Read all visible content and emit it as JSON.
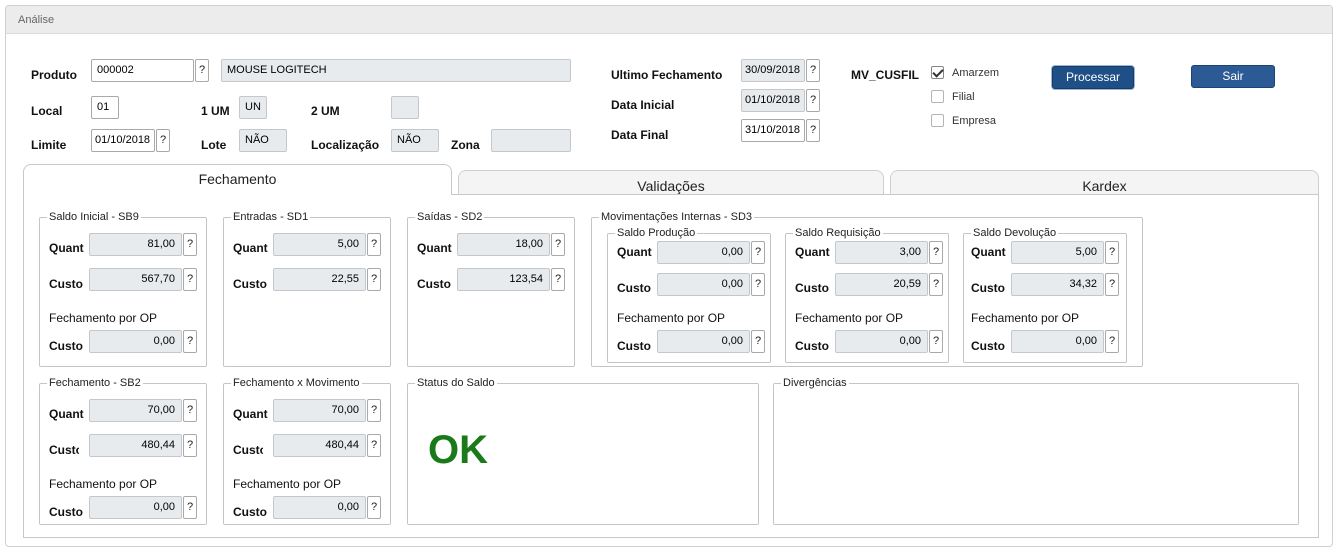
{
  "window": {
    "title": "Análise"
  },
  "header": {
    "produto": {
      "label": "Produto",
      "code": "000002",
      "description": "MOUSE LOGITECH"
    },
    "local": {
      "label": "Local",
      "value": "01"
    },
    "um1": {
      "label": "1 UM",
      "value": "UN"
    },
    "um2": {
      "label": "2 UM",
      "value": ""
    },
    "limite": {
      "label": "Limite",
      "value": "01/10/2018"
    },
    "lote": {
      "label": "Lote",
      "value": "NÃO"
    },
    "localizacao": {
      "label": "Localização",
      "value": "NÃO"
    },
    "zona": {
      "label": "Zona",
      "value": ""
    },
    "ultimo_fechamento": {
      "label": "Ultimo Fechamento",
      "value": "30/09/2018"
    },
    "data_inicial": {
      "label": "Data Inicial",
      "value": "01/10/2018"
    },
    "data_final": {
      "label": "Data Final",
      "value": "31/10/2018"
    },
    "mv_cusfil": {
      "label": "MV_CUSFIL"
    },
    "options": [
      {
        "label": "Amarzem",
        "checked": true
      },
      {
        "label": "Filial",
        "checked": false
      },
      {
        "label": "Empresa",
        "checked": false
      }
    ],
    "help": "?",
    "processar_label": "Processar",
    "sair_label": "Sair"
  },
  "tabs": [
    {
      "label": "Fechamento",
      "active": true
    },
    {
      "label": "Validações",
      "active": false
    },
    {
      "label": "Kardex",
      "active": false
    }
  ],
  "labels": {
    "quant": "Quant",
    "custo": "Custo",
    "custo_clipped": "Custo",
    "fechamento_op": "Fechamento por OP"
  },
  "groups": {
    "saldo_inicial": {
      "title": "Saldo Inicial - SB9",
      "quant": "81,00",
      "custo": "567,70",
      "custo_op": "0,00"
    },
    "entradas": {
      "title": "Entradas - SD1",
      "quant": "5,00",
      "custo": "22,55"
    },
    "saidas": {
      "title": "Saídas - SD2",
      "quant": "18,00",
      "custo": "123,54"
    },
    "mov_internas": {
      "title": "Movimentações Internas - SD3"
    },
    "saldo_producao": {
      "title": "Saldo Produção",
      "quant": "0,00",
      "custo": "0,00",
      "custo_op": "0,00"
    },
    "saldo_requisicao": {
      "title": "Saldo Requisição",
      "quant": "3,00",
      "custo": "20,59",
      "custo_op": "0,00"
    },
    "saldo_devolucao": {
      "title": "Saldo Devolução",
      "quant": "5,00",
      "custo": "34,32",
      "custo_op": "0,00"
    },
    "fechamento_sb2": {
      "title": "Fechamento - SB2",
      "quant": "70,00",
      "custo": "480,44",
      "custo_op": "0,00"
    },
    "fechamento_mov": {
      "title": "Fechamento x Movimento",
      "quant": "70,00",
      "custo": "480,44",
      "custo_op": "0,00"
    },
    "status": {
      "title": "Status do Saldo",
      "value": "OK"
    },
    "divergencias": {
      "title": "Divergências"
    }
  },
  "colors": {
    "ok": "#1a7a1a",
    "button": "#1f4f87"
  }
}
